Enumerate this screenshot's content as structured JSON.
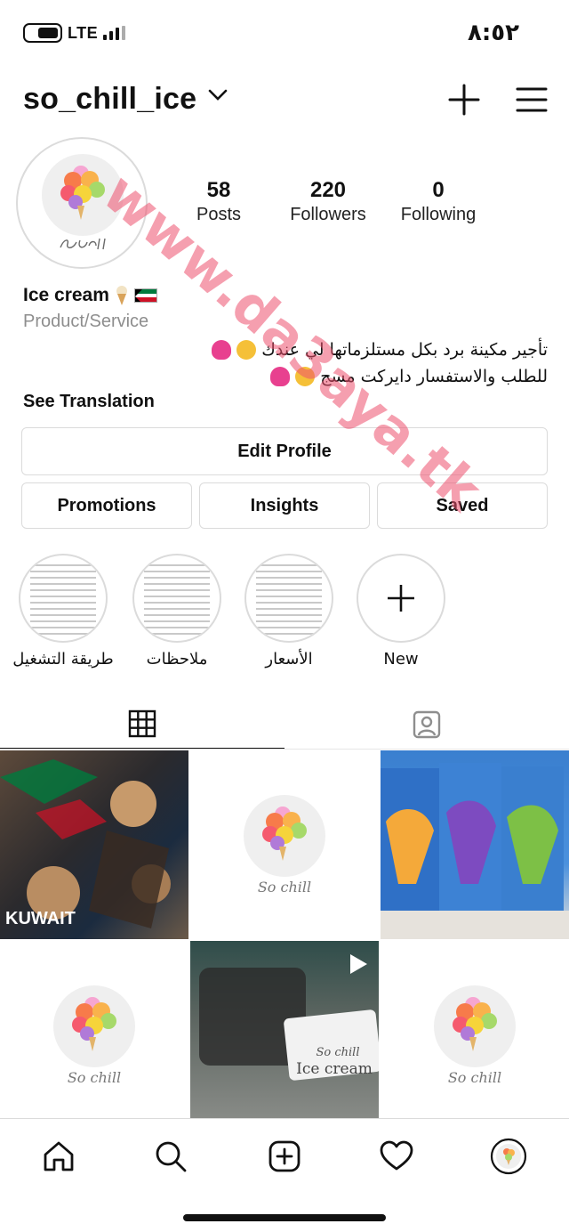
{
  "status_bar": {
    "network": "LTE",
    "time": "٨:٥٢"
  },
  "header": {
    "username": "so_chill_ice"
  },
  "stats": [
    {
      "value": "58",
      "label": "Posts"
    },
    {
      "value": "220",
      "label": "Followers"
    },
    {
      "value": "0",
      "label": "Following"
    }
  ],
  "bio": {
    "name": "Ice cream",
    "category": "Product/Service",
    "line1": "تأجير مكينة برد بكل مستلزماتها لي عندك",
    "line2": "للطلب والاستفسار دايركت مسج",
    "see_translation": "See Translation"
  },
  "buttons": {
    "edit_profile": "Edit Profile",
    "promotions": "Promotions",
    "insights": "Insights",
    "saved": "Saved"
  },
  "highlights": [
    {
      "label": "طريقة التشغيل"
    },
    {
      "label": "ملاحظات"
    },
    {
      "label": "الأسعار"
    },
    {
      "label": "New"
    }
  ],
  "grid_text": {
    "logo_caption": "So chill",
    "product_caption": "Ice cream",
    "flag_text": "KUWAIT"
  },
  "watermark": "www.da3aya.tk",
  "colors": {
    "accent_watermark": "#ec506e",
    "border": "#dbdbdb",
    "muted": "#8e8e8e"
  },
  "icons": {
    "header": [
      "chevron-down-icon",
      "plus-icon",
      "menu-icon"
    ],
    "tabs": [
      "grid-icon",
      "tagged-icon"
    ],
    "nav": [
      "home-icon",
      "search-icon",
      "new-post-icon",
      "heart-icon",
      "profile-avatar-icon"
    ]
  }
}
